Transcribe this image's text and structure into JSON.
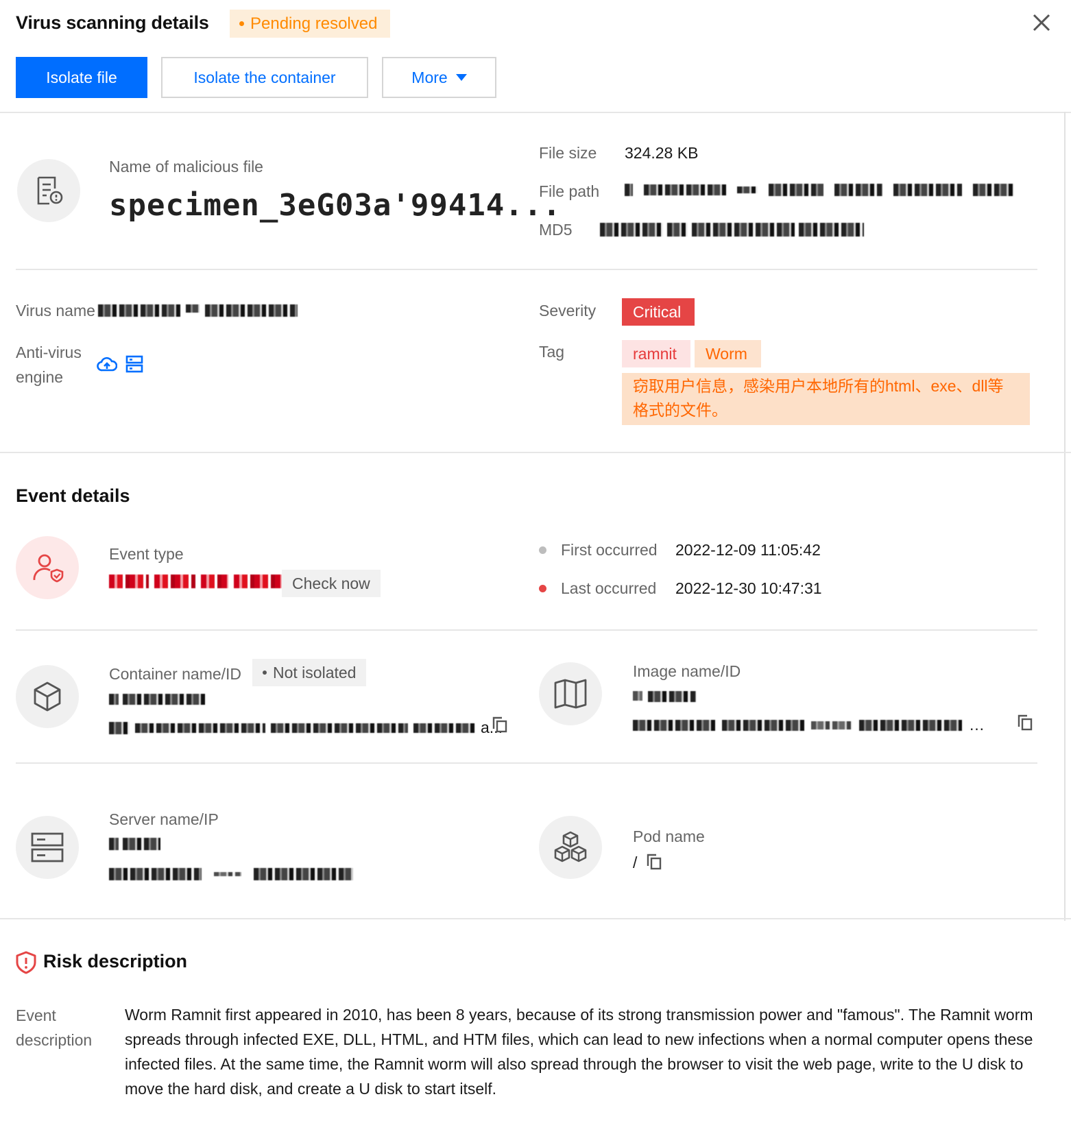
{
  "header": {
    "title": "Virus scanning details",
    "status_badge": "Pending resolved",
    "actions": {
      "isolate_file": "Isolate file",
      "isolate_container": "Isolate the container",
      "more": "More"
    }
  },
  "file": {
    "name_label": "Name of malicious file",
    "name_value": "specimen_3eG03a'99414...",
    "size_label": "File size",
    "size_value": "324.28 KB",
    "path_label": "File path",
    "md5_label": "MD5"
  },
  "virus": {
    "name_label": "Virus name",
    "engine_label_1": "Anti-virus",
    "engine_label_2": "engine",
    "severity_label": "Severity",
    "severity_value": "Critical",
    "tag_label": "Tag",
    "tags": [
      "ramnit",
      "Worm"
    ],
    "tag_description": "窃取用户信息，感染用户本地所有的html、exe、dll等格式的文件。"
  },
  "event": {
    "section_title": "Event details",
    "type_label": "Event type",
    "check_now": "Check now",
    "first_label": "First occurred",
    "first_value": "2022-12-09 11:05:42",
    "last_label": "Last occurred",
    "last_value": "2022-12-30 10:47:31",
    "container_label": "Container name/ID",
    "container_status": "Not isolated",
    "container_id_tail": "a...",
    "image_label": "Image name/ID",
    "server_label": "Server name/IP",
    "pod_label": "Pod name",
    "pod_value": "/"
  },
  "risk": {
    "section_title": "Risk description",
    "desc_label_1": "Event",
    "desc_label_2": "description",
    "desc_text": "Worm Ramnit first appeared in 2010, has been 8 years, because of its strong transmission power and \"famous\". The Ramnit worm spreads through infected EXE, DLL, HTML, and HTM files, which can lead to new infections when a normal computer opens these infected files. At the same time, the Ramnit worm will also spread through the browser to visit the web page, write to the U disk to move the hard disk, and create a U disk to start itself."
  },
  "colors": {
    "primary": "#006eff",
    "pending": "#ff8a00",
    "critical": "#e54545",
    "tag_orange": "#ff6600"
  }
}
